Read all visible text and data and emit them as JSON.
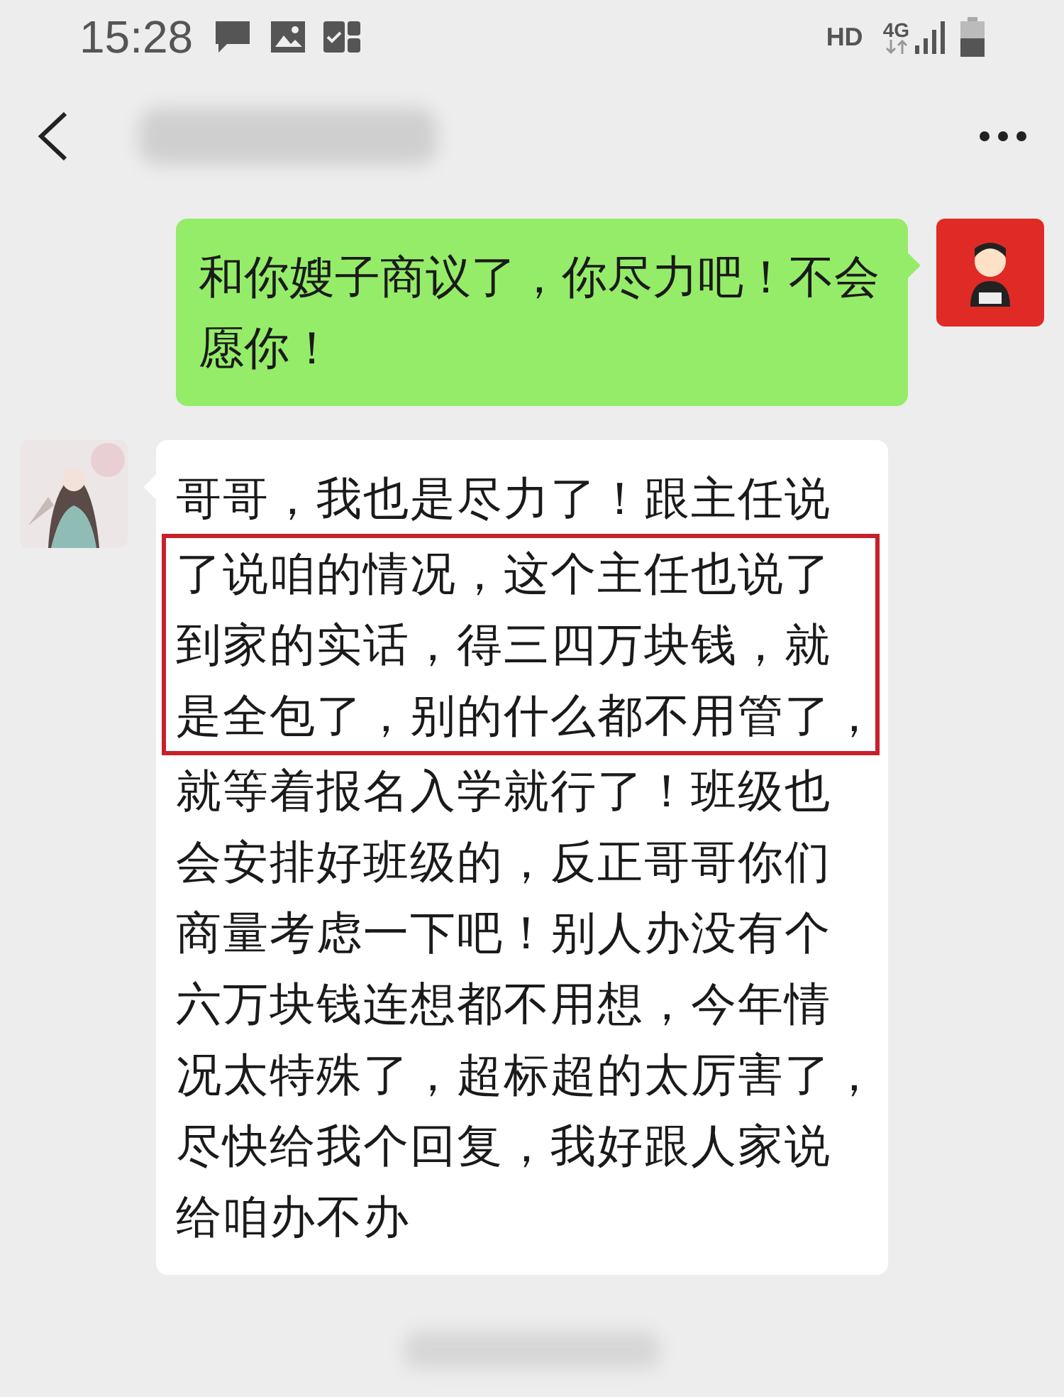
{
  "status_bar": {
    "time": "15:28",
    "network_label": "HD",
    "network_type": "4G"
  },
  "messages": [
    {
      "kind": "sent",
      "segments": [
        {
          "highlighted": false,
          "lines": [
            "和你嫂子商议了，你尽力吧！不会",
            "愿你！"
          ]
        }
      ]
    },
    {
      "kind": "received",
      "segments": [
        {
          "highlighted": false,
          "lines": [
            "哥哥，我也是尽力了！跟主任说"
          ]
        },
        {
          "highlighted": true,
          "lines": [
            "了说咱的情况，这个主任也说了",
            "到家的实话，得三四万块钱，就",
            "是全包了，别的什么都不用管了，"
          ]
        },
        {
          "highlighted": false,
          "lines": [
            "就等着报名入学就行了！班级也",
            "会安排好班级的，反正哥哥你们",
            "商量考虑一下吧！别人办没有个",
            "六万块钱连想都不用想，今年情",
            "况太特殊了，超标超的太厉害了，",
            "尽快给我个回复，我好跟人家说",
            "给咱办不办"
          ]
        }
      ]
    }
  ]
}
